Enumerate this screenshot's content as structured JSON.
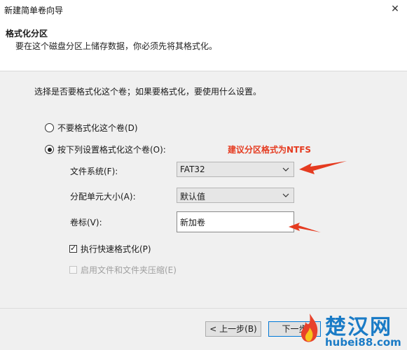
{
  "window": {
    "title": "新建简单卷向导",
    "close_glyph": "✕"
  },
  "header": {
    "title": "格式化分区",
    "subtitle": "要在这个磁盘分区上储存数据，你必须先将其格式化。"
  },
  "content": {
    "intro": "选择是否要格式化这个卷；如果要格式化，要使用什么设置。",
    "option_no_format": {
      "label": "不要格式化这个卷(D)",
      "selected": false
    },
    "option_format": {
      "label": "按下列设置格式化这个卷(O):",
      "selected": true
    },
    "file_system": {
      "label": "文件系统(F):",
      "value": "FAT32"
    },
    "allocation_unit": {
      "label": "分配单元大小(A):",
      "value": "默认值"
    },
    "volume_label": {
      "label": "卷标(V):",
      "value": "新加卷"
    },
    "quick_format": {
      "label": "执行快速格式化(P)",
      "checked": true
    },
    "compression": {
      "label": "启用文件和文件夹压缩(E)",
      "checked": false,
      "disabled": true
    }
  },
  "annotation": {
    "text": "建议分区格式为NTFS",
    "color": "#e53b20"
  },
  "footer": {
    "back_label": "< 上一步(B)",
    "next_label": "下一步"
  },
  "watermark": {
    "cn": "楚汉网",
    "en": "hubei88.com",
    "color": "#1a7bc6"
  }
}
